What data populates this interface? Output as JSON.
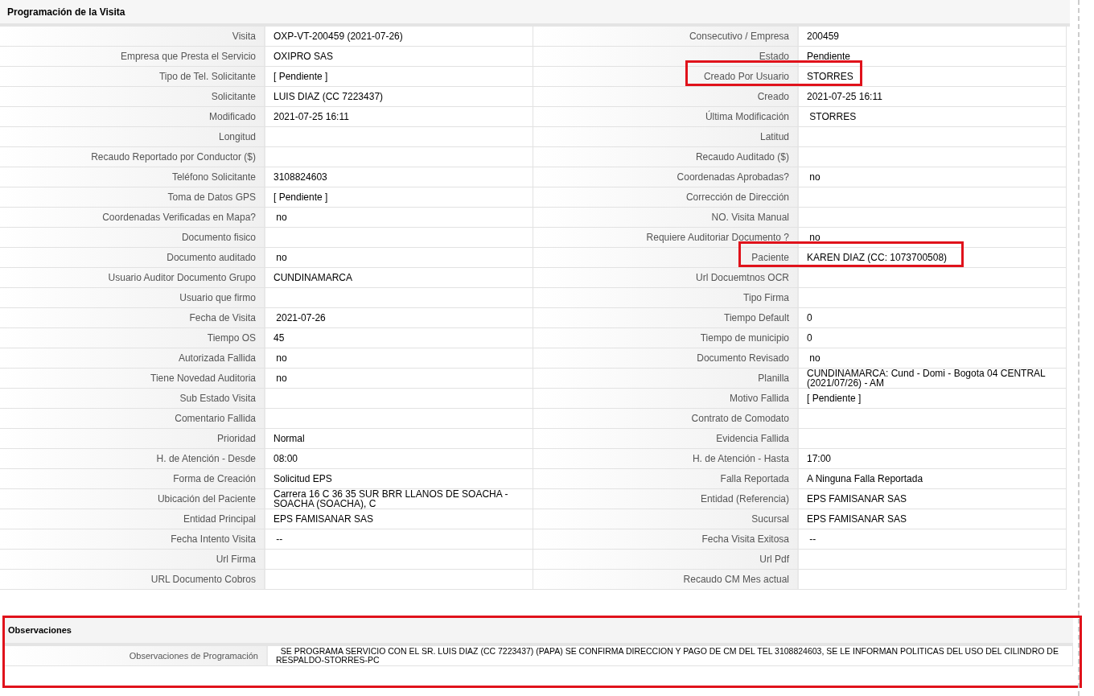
{
  "visit_section": {
    "title": "Programación de la Visita",
    "rows": [
      {
        "left": {
          "label": "Visita",
          "value": "OXP-VT-200459 (2021-07-26)",
          "highlighted": false
        },
        "right": {
          "label": "Consecutivo / Empresa",
          "value": "200459",
          "highlighted": false
        }
      },
      {
        "left": {
          "label": "Empresa que Presta el Servicio",
          "value": "OXIPRO SAS",
          "highlighted": false
        },
        "right": {
          "label": "Estado",
          "value": "Pendiente",
          "highlighted": false
        }
      },
      {
        "left": {
          "label": "Tipo de Tel. Solicitante",
          "value": "[ Pendiente ]",
          "highlighted": false
        },
        "right": {
          "label": "Creado Por Usuario",
          "value": "STORRES",
          "highlighted": true
        }
      },
      {
        "left": {
          "label": "Solicitante",
          "value": "LUIS DIAZ (CC 7223437)",
          "highlighted": false
        },
        "right": {
          "label": "Creado",
          "value": "2021-07-25 16:11",
          "highlighted": false
        }
      },
      {
        "left": {
          "label": "Modificado",
          "value": "2021-07-25 16:11",
          "highlighted": false
        },
        "right": {
          "label": "Última Modificación",
          "value": " STORRES",
          "highlighted": false
        }
      },
      {
        "left": {
          "label": "Longitud",
          "highlighted": false
        },
        "right": {
          "label": "Latitud",
          "highlighted": false
        }
      },
      {
        "left": {
          "label": "Recaudo Reportado por Conductor ($)",
          "highlighted": false
        },
        "right": {
          "label": "Recaudo Auditado ($)",
          "highlighted": false
        }
      },
      {
        "left": {
          "label": "Teléfono Solicitante",
          "value": "3108824603",
          "highlighted": false
        },
        "right": {
          "label": "Coordenadas Aprobadas?",
          "value": " no",
          "highlighted": false
        }
      },
      {
        "left": {
          "label": "Toma de Datos GPS",
          "value": "[ Pendiente ]",
          "highlighted": false
        },
        "right": {
          "label": "Corrección de Dirección",
          "highlighted": false
        }
      },
      {
        "left": {
          "label": "Coordenadas Verificadas en Mapa?",
          "value": " no",
          "highlighted": false
        },
        "right": {
          "label": "NO. Visita Manual",
          "highlighted": false
        }
      },
      {
        "left": {
          "label": "Documento fisico",
          "highlighted": false
        },
        "right": {
          "label": "Requiere Auditoriar Documento ?",
          "value": " no",
          "highlighted": false
        }
      },
      {
        "left": {
          "label": "Documento auditado",
          "value": " no",
          "highlighted": false
        },
        "right": {
          "label": "Paciente",
          "value": "KAREN DIAZ (CC: 1073700508)",
          "highlighted": true
        }
      },
      {
        "left": {
          "label": "Usuario Auditor Documento Grupo",
          "value": "CUNDINAMARCA",
          "highlighted": false
        },
        "right": {
          "label": "Url Docuemtnos OCR",
          "highlighted": false
        }
      },
      {
        "left": {
          "label": "Usuario que firmo",
          "highlighted": false
        },
        "right": {
          "label": "Tipo Firma",
          "highlighted": false
        }
      },
      {
        "left": {
          "label": "Fecha de Visita",
          "value": " 2021-07-26",
          "highlighted": false
        },
        "right": {
          "label": "Tiempo Default",
          "value": "0",
          "highlighted": false
        }
      },
      {
        "left": {
          "label": "Tiempo OS",
          "value": "45",
          "highlighted": false
        },
        "right": {
          "label": "Tiempo de municipio",
          "value": "0",
          "highlighted": false
        }
      },
      {
        "left": {
          "label": "Autorizada Fallida",
          "value": " no",
          "highlighted": false
        },
        "right": {
          "label": "Documento Revisado",
          "value": " no",
          "highlighted": false
        }
      },
      {
        "left": {
          "label": "Tiene Novedad Auditoria",
          "value": " no",
          "highlighted": false
        },
        "right": {
          "label": "Planilla",
          "value": "CUNDINAMARCA: Cund - Domi - Bogota 04 CENTRAL (2021/07/26) - AM",
          "highlighted": false
        }
      },
      {
        "left": {
          "label": "Sub Estado Visita",
          "highlighted": false
        },
        "right": {
          "label": "Motivo Fallida",
          "value": "[ Pendiente ]",
          "highlighted": false
        }
      },
      {
        "left": {
          "label": "Comentario Fallida",
          "highlighted": false
        },
        "right": {
          "label": "Contrato de Comodato",
          "highlighted": false
        }
      },
      {
        "left": {
          "label": "Prioridad",
          "value": "Normal",
          "highlighted": false
        },
        "right": {
          "label": "Evidencia Fallida",
          "highlighted": false
        }
      },
      {
        "left": {
          "label": "H. de Atención - Desde",
          "value": "08:00",
          "highlighted": false
        },
        "right": {
          "label": "H. de Atención - Hasta",
          "value": "17:00",
          "highlighted": false
        }
      },
      {
        "left": {
          "label": "Forma de Creación",
          "value": "Solicitud EPS",
          "highlighted": false
        },
        "right": {
          "label": "Falla Reportada",
          "value": "A Ninguna Falla Reportada",
          "highlighted": false
        }
      },
      {
        "left": {
          "label": "Ubicación del Paciente",
          "value": "Carrera 16 C 36 35 SUR BRR LLANOS DE SOACHA - SOACHA (SOACHA), C",
          "highlighted": false
        },
        "right": {
          "label": "Entidad (Referencia)",
          "value": "EPS FAMISANAR SAS",
          "highlighted": false
        }
      },
      {
        "left": {
          "label": "Entidad Principal",
          "value": "EPS FAMISANAR SAS",
          "highlighted": false
        },
        "right": {
          "label": "Sucursal",
          "value": "EPS FAMISANAR SAS",
          "highlighted": false
        }
      },
      {
        "left": {
          "label": "Fecha Intento Visita",
          "value": " --",
          "highlighted": false
        },
        "right": {
          "label": "Fecha Visita Exitosa",
          "value": " --",
          "highlighted": false
        }
      },
      {
        "left": {
          "label": "Url Firma",
          "highlighted": false
        },
        "right": {
          "label": "Url Pdf",
          "highlighted": false
        }
      },
      {
        "left": {
          "label": "URL Documento Cobros",
          "highlighted": false
        },
        "right": {
          "label": "Recaudo CM Mes actual",
          "highlighted": false
        }
      }
    ]
  },
  "observations_section": {
    "title": "Observaciones",
    "highlighted": true,
    "rows": [
      {
        "label": "Observaciones de Programación",
        "value": "  SE PROGRAMA SERVICIO CON EL SR. LUIS DIAZ (CC 7223437) (PAPA) SE CONFIRMA DIRECCION Y PAGO DE CM DEL TEL 3108824603, SE LE INFORMAN POLITICAS DEL USO DEL CILINDRO DE RESPALDO-STORRES-PC"
      }
    ]
  }
}
